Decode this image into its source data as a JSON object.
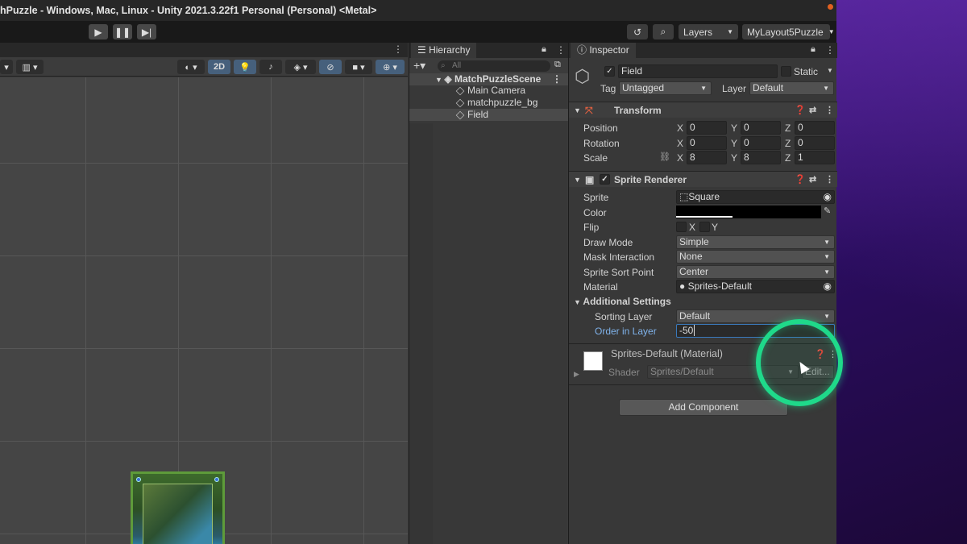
{
  "window": {
    "title": "hPuzzle - Windows, Mac, Linux - Unity 2021.3.22f1 Personal (Personal) <Metal>"
  },
  "toolbar": {
    "layers_label": "Layers",
    "layout_label": "MyLayout5Puzzle"
  },
  "scene_toolbar": {
    "mode_2d_label": "2D"
  },
  "hierarchy": {
    "tab_label": "Hierarchy",
    "search_placeholder": "All",
    "scene_name": "MatchPuzzleScene",
    "items": [
      "Main Camera",
      "matchpuzzle_bg",
      "Field"
    ]
  },
  "inspector": {
    "tab_label": "Inspector",
    "object_name": "Field",
    "static_label": "Static",
    "tag_label": "Tag",
    "tag_value": "Untagged",
    "layer_label": "Layer",
    "layer_value": "Default",
    "transform": {
      "title": "Transform",
      "position_label": "Position",
      "rotation_label": "Rotation",
      "scale_label": "Scale",
      "position": {
        "x": "0",
        "y": "0",
        "z": "0"
      },
      "rotation": {
        "x": "0",
        "y": "0",
        "z": "0"
      },
      "scale": {
        "x": "8",
        "y": "8",
        "z": "1"
      },
      "axis_x": "X",
      "axis_y": "Y",
      "axis_z": "Z"
    },
    "sprite_renderer": {
      "title": "Sprite Renderer",
      "sprite_label": "Sprite",
      "sprite_value": "Square",
      "color_label": "Color",
      "flip_label": "Flip",
      "flip_x": "X",
      "flip_y": "Y",
      "draw_mode_label": "Draw Mode",
      "draw_mode_value": "Simple",
      "mask_label": "Mask Interaction",
      "mask_value": "None",
      "sort_point_label": "Sprite Sort Point",
      "sort_point_value": "Center",
      "material_label": "Material",
      "material_value": "Sprites-Default",
      "additional_label": "Additional Settings",
      "sorting_layer_label": "Sorting Layer",
      "sorting_layer_value": "Default",
      "order_label": "Order in Layer",
      "order_value": "-50"
    },
    "material": {
      "title": "Sprites-Default (Material)",
      "shader_label": "Shader",
      "shader_value": "Sprites/Default",
      "edit_label": "Edit..."
    },
    "add_component_label": "Add Component"
  },
  "colors": {
    "accent_ring": "#1fd98a",
    "sprite_color": "#000000"
  }
}
